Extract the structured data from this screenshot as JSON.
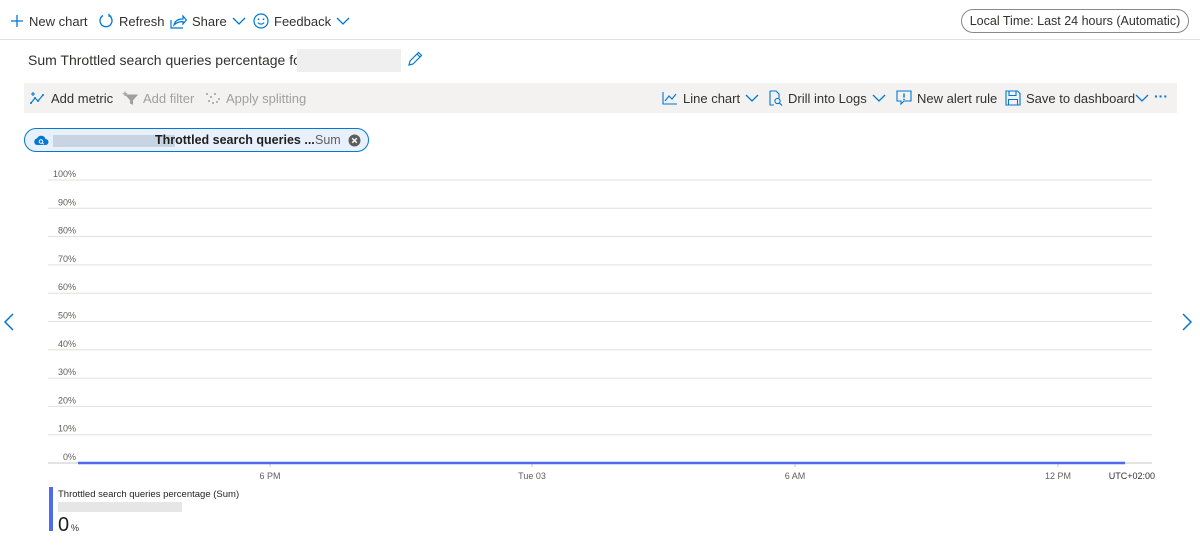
{
  "topbar": {
    "new_chart": "New chart",
    "refresh": "Refresh",
    "share": "Share",
    "feedback": "Feedback",
    "time_range": "Local Time: Last 24 hours (Automatic)"
  },
  "chart_header": {
    "title": "Sum Throttled search queries percentage for"
  },
  "toolbar": {
    "add_metric": "Add metric",
    "add_filter": "Add filter",
    "apply_splitting": "Apply splitting",
    "line_chart": "Line chart",
    "drill_into_logs": "Drill into Logs",
    "new_alert_rule": "New alert rule",
    "save_to_dashboard": "Save to dashboard",
    "more": "···"
  },
  "metric_pill": {
    "metric_name": "Throttled search queries ...",
    "aggregation": "Sum"
  },
  "colors": {
    "accent": "#0078d4",
    "series": "#4f6bed",
    "toolbar_bg": "#f3f2f1",
    "pill_bg": "#e8f0fb"
  },
  "chart_data": {
    "type": "line",
    "y_ticks": [
      "100%",
      "90%",
      "80%",
      "70%",
      "60%",
      "50%",
      "40%",
      "30%",
      "20%",
      "10%",
      "0%"
    ],
    "x_ticks": [
      "6 PM",
      "Tue 03",
      "6 AM",
      "12 PM"
    ],
    "timezone": "UTC+02:00",
    "ylim": [
      0,
      100
    ],
    "grid": true,
    "series": [
      {
        "name": "Throttled search queries percentage (Sum)",
        "color": "#4f6bed",
        "values": [
          0,
          0,
          0,
          0,
          0,
          0,
          0,
          0,
          0,
          0,
          0,
          0,
          0,
          0,
          0,
          0,
          0,
          0,
          0,
          0,
          0,
          0,
          0,
          0
        ]
      }
    ]
  },
  "legend": {
    "series_name": "Throttled search queries percentage (Sum)",
    "value": "0",
    "unit": "%"
  }
}
